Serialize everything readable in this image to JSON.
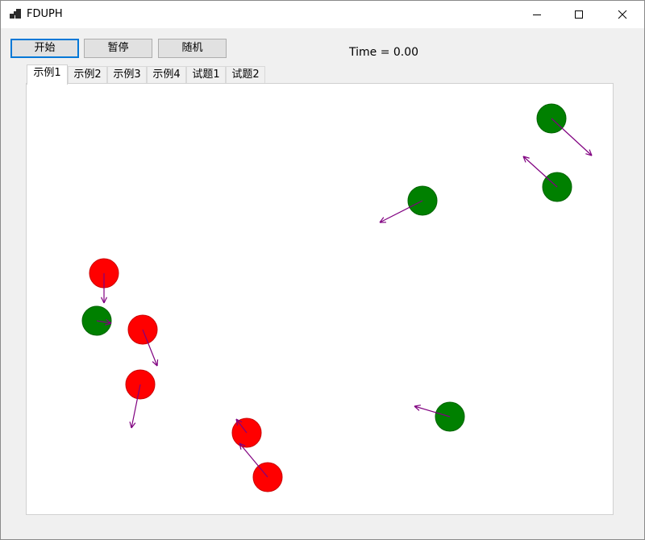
{
  "window": {
    "title": "FDUPH"
  },
  "toolbar": {
    "start_label": "开始",
    "pause_label": "暂停",
    "random_label": "随机"
  },
  "status": {
    "time_text": "Time = 0.00"
  },
  "tabs": [
    {
      "label": "示例1",
      "active": true
    },
    {
      "label": "示例2",
      "active": false
    },
    {
      "label": "示例3",
      "active": false
    },
    {
      "label": "示例4",
      "active": false
    },
    {
      "label": "试题1",
      "active": false
    },
    {
      "label": "试题2",
      "active": false
    }
  ],
  "colors": {
    "red_ball": "#ff0000",
    "green_ball": "#008000",
    "velocity_arrow": "#800080"
  },
  "icons": {
    "minimize": "minimize-icon",
    "maximize": "maximize-icon",
    "close": "close-icon"
  }
}
